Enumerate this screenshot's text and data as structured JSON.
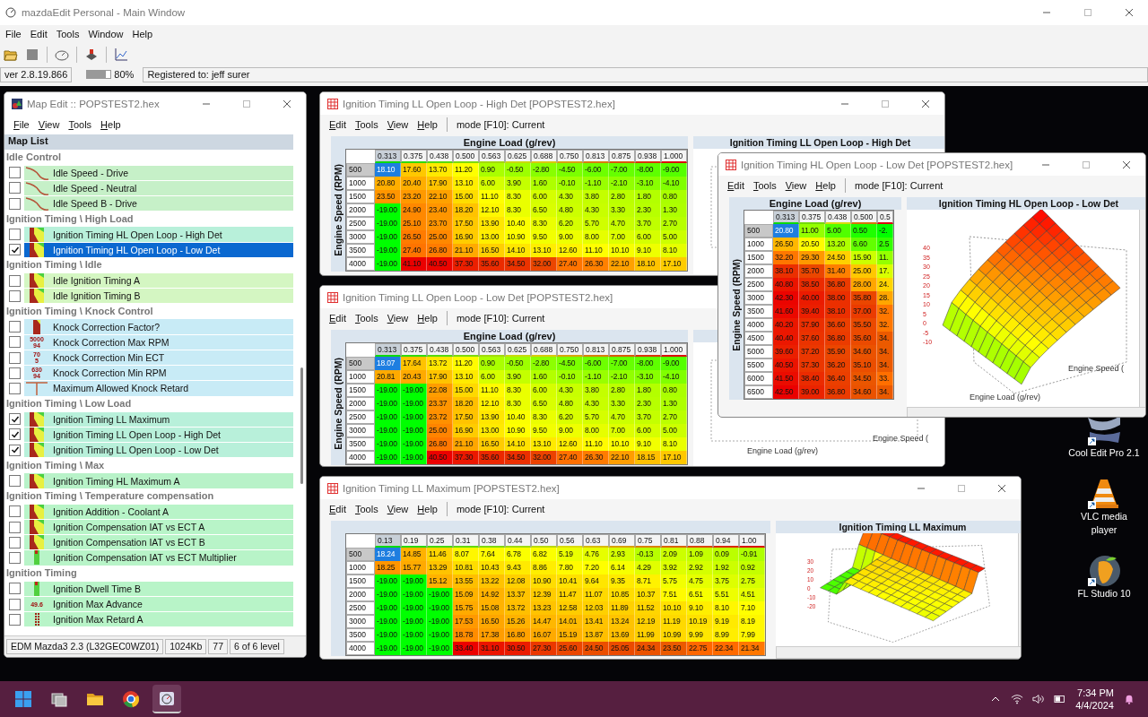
{
  "main_window": {
    "title": "mazdaEdit Personal - Main Window",
    "menu": [
      "File",
      "Edit",
      "Tools",
      "Window",
      "Help"
    ],
    "version": "ver 2.8.19.866",
    "progress": {
      "level": 0.8,
      "reading": "80%"
    },
    "registered": "Registered to: jeff surer"
  },
  "map_edit": {
    "title": "Map Edit :: POPSTEST2.hex",
    "menu": [
      "File",
      "View",
      "Tools",
      "Help"
    ],
    "list_title": "Map List",
    "groups": [
      {
        "label": "Idle Control",
        "items": [
          {
            "label": "Idle Speed - Drive",
            "checked": false,
            "selected": false,
            "kind": "curve",
            "color": "#c6f0c8"
          },
          {
            "label": "Idle Speed - Neutral",
            "checked": false,
            "selected": false,
            "kind": "curve",
            "color": "#c6f0c8"
          },
          {
            "label": "Idle Speed B - Drive",
            "checked": false,
            "selected": false,
            "kind": "curve",
            "color": "#c6f0c8"
          }
        ]
      },
      {
        "label": "Ignition Timing \\ High Load",
        "items": [
          {
            "label": "Ignition Timing HL Open Loop - High Det",
            "checked": false,
            "selected": false,
            "kind": "map",
            "color": "#b8f0da"
          },
          {
            "label": "Ignition Timing HL Open Loop - Low Det",
            "checked": true,
            "selected": true,
            "kind": "map"
          }
        ]
      },
      {
        "label": "Ignition Timing \\ Idle",
        "items": [
          {
            "label": "Idle Ignition Timing A",
            "checked": false,
            "selected": false,
            "kind": "map",
            "color": "#d4f6c2"
          },
          {
            "label": "Idle Ignition Timing B",
            "checked": false,
            "selected": false,
            "kind": "map",
            "color": "#d4f6c2"
          }
        ]
      },
      {
        "label": "Ignition Timing \\ Knock Control",
        "items": [
          {
            "label": "Knock Correction Factor?",
            "checked": false,
            "selected": false,
            "kind": "block",
            "color": "#c8ebf6"
          },
          {
            "label": "Knock Correction Max RPM",
            "checked": false,
            "selected": false,
            "kind": "value",
            "icon_text": "5000\n94",
            "color": "#c8ebf6"
          },
          {
            "label": "Knock Correction Min ECT",
            "checked": false,
            "selected": false,
            "kind": "value",
            "icon_text": "70\n5",
            "color": "#c8ebf6"
          },
          {
            "label": "Knock Correction Min RPM",
            "checked": false,
            "selected": false,
            "kind": "value",
            "icon_text": "630\n94",
            "color": "#c8ebf6"
          },
          {
            "label": "Maximum Allowed Knock Retard",
            "checked": false,
            "selected": false,
            "kind": "tee",
            "color": "#c8ebf6"
          }
        ]
      },
      {
        "label": "Ignition Timing \\ Low Load",
        "items": [
          {
            "label": "Ignition Timing LL Maximum",
            "checked": true,
            "selected": false,
            "kind": "map",
            "color": "#b8f0da"
          },
          {
            "label": "Ignition Timing LL Open Loop - High Det",
            "checked": true,
            "selected": false,
            "kind": "map",
            "color": "#b8f0da"
          },
          {
            "label": "Ignition Timing LL Open Loop - Low Det",
            "checked": true,
            "selected": false,
            "kind": "map",
            "color": "#b8f0da"
          }
        ]
      },
      {
        "label": "Ignition Timing \\ Max",
        "items": [
          {
            "label": "Ignition Timing HL Maximum A",
            "checked": false,
            "selected": false,
            "kind": "map",
            "color": "#b8f2c8"
          }
        ]
      },
      {
        "label": "Ignition Timing \\ Temperature compensation",
        "items": [
          {
            "label": "Ignition Addition - Coolant A",
            "checked": false,
            "selected": false,
            "kind": "map",
            "color": "#b8f4c8"
          },
          {
            "label": "Ignition Compensation IAT vs ECT A",
            "checked": false,
            "selected": false,
            "kind": "map",
            "color": "#b8f4c8"
          },
          {
            "label": "Ignition Compensation IAT vs ECT B",
            "checked": false,
            "selected": false,
            "kind": "map",
            "color": "#b8f4c8"
          },
          {
            "label": "Ignition Compensation IAT vs ECT Multiplier",
            "checked": false,
            "selected": false,
            "kind": "strip",
            "color": "#b8f4c8"
          }
        ]
      },
      {
        "label": "Ignition Timing",
        "items": [
          {
            "label": "Ignition Dwell Time B",
            "checked": false,
            "selected": false,
            "kind": "strip",
            "color": "#b8f4c8"
          },
          {
            "label": "Ignition Max Advance",
            "checked": false,
            "selected": false,
            "kind": "value",
            "icon_text": "49.6",
            "color": "#b8f4c8"
          },
          {
            "label": "Ignition Max Retard A",
            "checked": false,
            "selected": false,
            "kind": "dots",
            "color": "#b8f4c8"
          }
        ]
      }
    ],
    "status": [
      "EDM Mazda3 2.3 (L32GEC0WZ01)",
      "1024Kb",
      "77",
      "6 of 6 level"
    ]
  },
  "tables": [
    {
      "title": "Ignition Timing LL Open Loop - High Det [POPSTEST2.hex]",
      "menu": [
        "Edit",
        "Tools",
        "View",
        "Help"
      ],
      "mode": "mode [F10]: Current",
      "x_title": "Engine Load (g/rev)",
      "y_title": "Engine Speed (RPM)",
      "columns": [
        {
          "label": "0.313",
          "selected": true
        },
        {
          "label": "0.375",
          "selected": false
        },
        {
          "label": "0.438",
          "selected": false
        },
        {
          "label": "0.500",
          "selected": false
        },
        {
          "label": "0.563",
          "selected": false
        },
        {
          "label": "0.625",
          "selected": false
        },
        {
          "label": "0.688",
          "selected": false
        },
        {
          "label": "0.750",
          "selected": false
        },
        {
          "label": "0.813",
          "selected": false
        },
        {
          "label": "0.875",
          "selected": false
        },
        {
          "label": "0.938",
          "selected": false
        },
        {
          "label": "1.000",
          "selected": false
        }
      ],
      "rows": [
        {
          "label": "500",
          "selected": true,
          "values": [
            "18.10",
            "17.60",
            "13.70",
            "11.20",
            "0.90",
            "-0.50",
            "-2.80",
            "-4.50",
            "-6.00",
            "-7.00",
            "-8.00",
            "-9.00"
          ]
        },
        {
          "label": "1000",
          "selected": false,
          "values": [
            "20.80",
            "20.40",
            "17.90",
            "13.10",
            "6.00",
            "3.90",
            "1.60",
            "-0.10",
            "-1.10",
            "-2.10",
            "-3.10",
            "-4.10"
          ]
        },
        {
          "label": "1500",
          "selected": false,
          "values": [
            "23.50",
            "23.20",
            "22.10",
            "15.00",
            "11.10",
            "8.30",
            "6.00",
            "4.30",
            "3.80",
            "2.80",
            "1.80",
            "0.80"
          ]
        },
        {
          "label": "2000",
          "selected": false,
          "values": [
            "-19.00",
            "24.90",
            "23.40",
            "18.20",
            "12.10",
            "8.30",
            "6.50",
            "4.80",
            "4.30",
            "3.30",
            "2.30",
            "1.30"
          ]
        },
        {
          "label": "2500",
          "selected": false,
          "values": [
            "-19.00",
            "25.10",
            "23.70",
            "17.50",
            "13.90",
            "10.40",
            "8.30",
            "6.20",
            "5.70",
            "4.70",
            "3.70",
            "2.70"
          ]
        },
        {
          "label": "3000",
          "selected": false,
          "values": [
            "-19.00",
            "26.50",
            "25.00",
            "16.90",
            "13.00",
            "10.90",
            "9.50",
            "9.00",
            "8.00",
            "7.00",
            "6.00",
            "5.00"
          ]
        },
        {
          "label": "3500",
          "selected": false,
          "values": [
            "-19.00",
            "27.40",
            "26.80",
            "21.10",
            "16.50",
            "14.10",
            "13.10",
            "12.60",
            "11.10",
            "10.10",
            "9.10",
            "8.10"
          ]
        },
        {
          "label": "4000",
          "selected": false,
          "values": [
            "-19.00",
            "41.10",
            "40.50",
            "37.30",
            "35.60",
            "34.50",
            "32.00",
            "27.40",
            "26.30",
            "22.10",
            "18.10",
            "17.10"
          ]
        }
      ],
      "plot": {
        "title": "Ignition Timing LL Open Loop - High Det"
      }
    },
    {
      "title": "Ignition Timing HL Open Loop - Low Det [POPSTEST2.hex]",
      "menu": [
        "Edit",
        "Tools",
        "View",
        "Help"
      ],
      "mode": "mode [F10]: Current",
      "x_title": "Engine Load (g/rev)",
      "y_title": "Engine Speed (RPM)",
      "columns": [
        {
          "label": "0.313",
          "selected": true
        },
        {
          "label": "0.375",
          "selected": false
        },
        {
          "label": "0.438",
          "selected": false
        },
        {
          "label": "0.500",
          "selected": false
        },
        {
          "label": "0.5",
          "selected": false
        }
      ],
      "rows": [
        {
          "label": "500",
          "selected": true,
          "values": [
            "20.80",
            "11.00",
            "5.00",
            "0.50",
            "-2."
          ]
        },
        {
          "label": "1000",
          "selected": false,
          "values": [
            "26.50",
            "20.50",
            "13.20",
            "6.60",
            "2.5"
          ]
        },
        {
          "label": "1500",
          "selected": false,
          "values": [
            "32.20",
            "29.30",
            "24.50",
            "15.90",
            "11."
          ]
        },
        {
          "label": "2000",
          "selected": false,
          "values": [
            "38.10",
            "35.70",
            "31.40",
            "25.00",
            "17."
          ]
        },
        {
          "label": "2500",
          "selected": false,
          "values": [
            "40.80",
            "38.50",
            "36.80",
            "28.00",
            "24."
          ]
        },
        {
          "label": "3000",
          "selected": false,
          "values": [
            "42.30",
            "40.00",
            "38.00",
            "35.80",
            "28."
          ]
        },
        {
          "label": "3500",
          "selected": false,
          "values": [
            "41.60",
            "39.40",
            "38.10",
            "37.00",
            "32."
          ]
        },
        {
          "label": "4000",
          "selected": false,
          "values": [
            "40.20",
            "37.90",
            "36.60",
            "35.50",
            "32."
          ]
        },
        {
          "label": "4500",
          "selected": false,
          "values": [
            "40.40",
            "37.60",
            "36.80",
            "35.60",
            "34."
          ]
        },
        {
          "label": "5000",
          "selected": false,
          "values": [
            "39.60",
            "37.20",
            "35.90",
            "34.60",
            "34."
          ]
        },
        {
          "label": "5500",
          "selected": false,
          "values": [
            "40.50",
            "37.30",
            "36.20",
            "35.10",
            "34."
          ]
        },
        {
          "label": "6000",
          "selected": false,
          "values": [
            "41.50",
            "38.40",
            "36.40",
            "34.50",
            "33."
          ]
        },
        {
          "label": "6500",
          "selected": false,
          "values": [
            "42.50",
            "39.00",
            "36.80",
            "34.60",
            "34."
          ]
        }
      ],
      "plot": {
        "title": "Ignition Timing HL Open Loop - Low Det",
        "z_ticks": [
          "40",
          "35",
          "30",
          "25",
          "20",
          "15",
          "10",
          "5",
          "0",
          "-5",
          "-10"
        ],
        "x_label": "Engine Load (g/rev)",
        "y_label": "Engine Speed ("
      }
    },
    {
      "title": "Ignition Timing LL Open Loop - Low Det [POPSTEST2.hex]",
      "menu": [
        "Edit",
        "Tools",
        "View",
        "Help"
      ],
      "mode": "mode [F10]: Current",
      "x_title": "Engine Load (g/rev)",
      "y_title": "Engine Speed (RPM)",
      "columns": [
        {
          "label": "0.313",
          "selected": true
        },
        {
          "label": "0.375",
          "selected": false
        },
        {
          "label": "0.438",
          "selected": false
        },
        {
          "label": "0.500",
          "selected": false
        },
        {
          "label": "0.563",
          "selected": false
        },
        {
          "label": "0.625",
          "selected": false
        },
        {
          "label": "0.688",
          "selected": false
        },
        {
          "label": "0.750",
          "selected": false
        },
        {
          "label": "0.813",
          "selected": false
        },
        {
          "label": "0.875",
          "selected": false
        },
        {
          "label": "0.938",
          "selected": false
        },
        {
          "label": "1.000",
          "selected": false
        }
      ],
      "rows": [
        {
          "label": "500",
          "selected": true,
          "values": [
            "18.07",
            "17.64",
            "13.72",
            "11.20",
            "0.90",
            "-0.50",
            "-2.80",
            "-4.50",
            "-6.00",
            "-7.00",
            "-8.00",
            "-9.00"
          ]
        },
        {
          "label": "1000",
          "selected": false,
          "values": [
            "20.81",
            "20.43",
            "17.90",
            "13.10",
            "6.00",
            "3.90",
            "1.60",
            "-0.10",
            "-1.10",
            "-2.10",
            "-3.10",
            "-4.10"
          ]
        },
        {
          "label": "1500",
          "selected": false,
          "values": [
            "-19.00",
            "-19.00",
            "22.08",
            "15.00",
            "11.10",
            "8.30",
            "6.00",
            "4.30",
            "3.80",
            "2.80",
            "1.80",
            "0.80"
          ]
        },
        {
          "label": "2000",
          "selected": false,
          "values": [
            "-19.00",
            "-19.00",
            "23.37",
            "18.20",
            "12.10",
            "8.30",
            "6.50",
            "4.80",
            "4.30",
            "3.30",
            "2.30",
            "1.30"
          ]
        },
        {
          "label": "2500",
          "selected": false,
          "values": [
            "-19.00",
            "-19.00",
            "23.72",
            "17.50",
            "13.90",
            "10.40",
            "8.30",
            "6.20",
            "5.70",
            "4.70",
            "3.70",
            "2.70"
          ]
        },
        {
          "label": "3000",
          "selected": false,
          "values": [
            "-19.00",
            "-19.00",
            "25.00",
            "16.90",
            "13.00",
            "10.90",
            "9.50",
            "9.00",
            "8.00",
            "7.00",
            "6.00",
            "5.00"
          ]
        },
        {
          "label": "3500",
          "selected": false,
          "values": [
            "-19.00",
            "-19.00",
            "26.80",
            "21.10",
            "16.50",
            "14.10",
            "13.10",
            "12.60",
            "11.10",
            "10.10",
            "9.10",
            "8.10"
          ]
        },
        {
          "label": "4000",
          "selected": false,
          "values": [
            "-19.00",
            "-19.00",
            "40.50",
            "37.30",
            "35.60",
            "34.50",
            "32.00",
            "27.40",
            "26.30",
            "22.10",
            "18.15",
            "17.10"
          ]
        }
      ],
      "plot": {
        "x_label": "Engine Load (g/rev)",
        "y_label": "Engine Speed ("
      }
    },
    {
      "title": "Ignition Timing LL Maximum [POPSTEST2.hex]",
      "menu": [
        "Edit",
        "Tools",
        "View",
        "Help"
      ],
      "mode": "mode [F10]: Current",
      "columns": [
        {
          "label": "0.13",
          "selected": true
        },
        {
          "label": "0.19",
          "selected": false
        },
        {
          "label": "0.25",
          "selected": false
        },
        {
          "label": "0.31",
          "selected": false
        },
        {
          "label": "0.38",
          "selected": false
        },
        {
          "label": "0.44",
          "selected": false
        },
        {
          "label": "0.50",
          "selected": false
        },
        {
          "label": "0.56",
          "selected": false
        },
        {
          "label": "0.63",
          "selected": false
        },
        {
          "label": "0.69",
          "selected": false
        },
        {
          "label": "0.75",
          "selected": false
        },
        {
          "label": "0.81",
          "selected": false
        },
        {
          "label": "0.88",
          "selected": false
        },
        {
          "label": "0.94",
          "selected": false
        },
        {
          "label": "1.00",
          "selected": false
        }
      ],
      "rows": [
        {
          "label": "500",
          "selected": true,
          "values": [
            "18.24",
            "14.85",
            "11.46",
            "8.07",
            "7.64",
            "6.78",
            "6.82",
            "5.19",
            "4.76",
            "2.93",
            "-0.13",
            "2.09",
            "1.09",
            "0.09",
            "-0.91"
          ]
        },
        {
          "label": "1000",
          "selected": false,
          "values": [
            "18.25",
            "15.77",
            "13.29",
            "10.81",
            "10.43",
            "9.43",
            "8.86",
            "7.80",
            "7.20",
            "6.14",
            "4.29",
            "3.92",
            "2.92",
            "1.92",
            "0.92"
          ]
        },
        {
          "label": "1500",
          "selected": false,
          "values": [
            "-19.00",
            "-19.00",
            "15.12",
            "13.55",
            "13.22",
            "12.08",
            "10.90",
            "10.41",
            "9.64",
            "9.35",
            "8.71",
            "5.75",
            "4.75",
            "3.75",
            "2.75"
          ]
        },
        {
          "label": "2000",
          "selected": false,
          "values": [
            "-19.00",
            "-19.00",
            "-19.00",
            "15.09",
            "14.92",
            "13.37",
            "12.39",
            "11.47",
            "11.07",
            "10.85",
            "10.37",
            "7.51",
            "6.51",
            "5.51",
            "4.51"
          ]
        },
        {
          "label": "2500",
          "selected": false,
          "values": [
            "-19.00",
            "-19.00",
            "-19.00",
            "15.75",
            "15.08",
            "13.72",
            "13.23",
            "12.58",
            "12.03",
            "11.89",
            "11.52",
            "10.10",
            "9.10",
            "8.10",
            "7.10"
          ]
        },
        {
          "label": "3000",
          "selected": false,
          "values": [
            "-19.00",
            "-19.00",
            "-19.00",
            "17.53",
            "16.50",
            "15.26",
            "14.47",
            "14.01",
            "13.41",
            "13.24",
            "12.19",
            "11.19",
            "10.19",
            "9.19",
            "8.19"
          ]
        },
        {
          "label": "3500",
          "selected": false,
          "values": [
            "-19.00",
            "-19.00",
            "-19.00",
            "18.78",
            "17.38",
            "16.80",
            "16.07",
            "15.19",
            "13.87",
            "13.69",
            "11.99",
            "10.99",
            "9.99",
            "8.99",
            "7.99"
          ]
        },
        {
          "label": "4000",
          "selected": false,
          "values": [
            "-19.00",
            "-19.00",
            "-19.00",
            "33.40",
            "31.10",
            "30.50",
            "27.30",
            "25.60",
            "24.50",
            "25.05",
            "24.34",
            "23.50",
            "22.75",
            "22.34",
            "21.34"
          ]
        }
      ],
      "plot": {
        "title": "Ignition Timing LL Maximum",
        "z_ticks": [
          "30",
          "20",
          "10",
          "0",
          "-10",
          "-20"
        ]
      }
    }
  ],
  "desktop_icons": [
    {
      "label": "Cool Edit Pro 2.1",
      "kind": "swoosh"
    },
    {
      "label": "VLC media player",
      "kind": "cone"
    },
    {
      "label": "FL Studio 10",
      "kind": "fruit"
    }
  ],
  "taskbar": {
    "apps": [
      {
        "kind": "start",
        "active": false
      },
      {
        "kind": "taskview",
        "active": false
      },
      {
        "kind": "folder",
        "active": false
      },
      {
        "kind": "browser",
        "active": false
      },
      {
        "kind": "gauge",
        "active": true
      }
    ],
    "time": "7:34 PM",
    "date": "4/4/2024"
  }
}
